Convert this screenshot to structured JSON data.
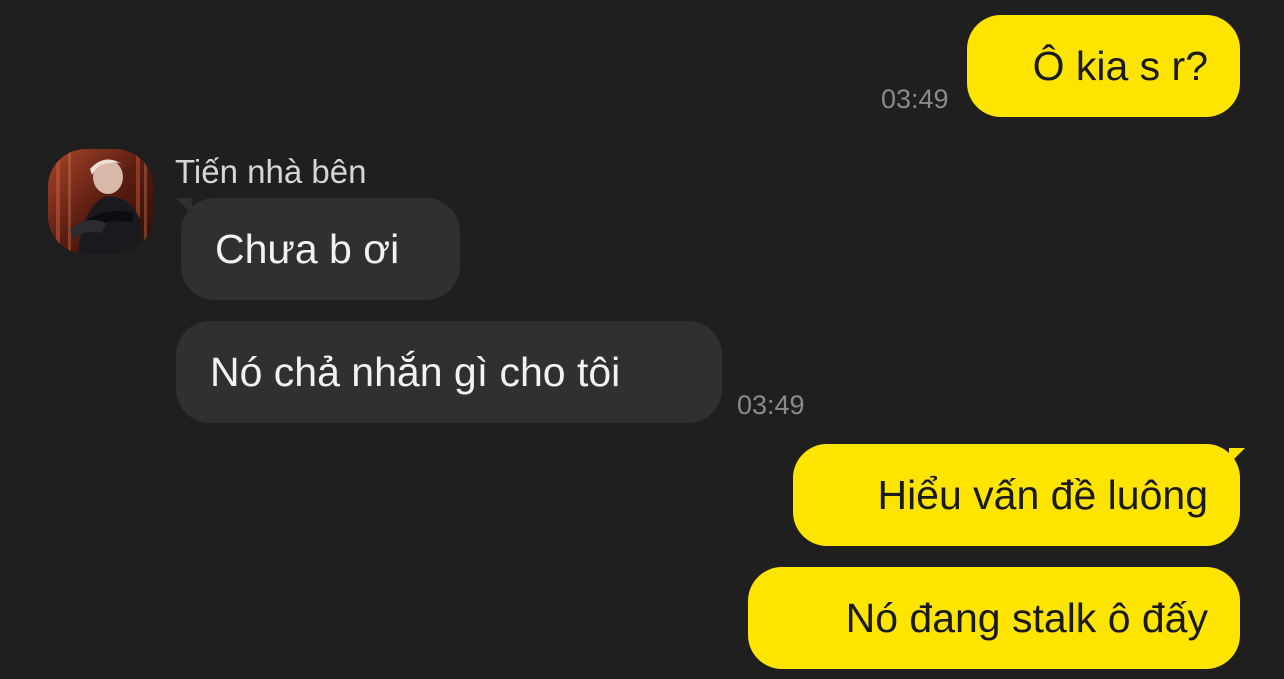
{
  "messages": [
    {
      "side": "me",
      "text": "Ô kia s r?",
      "time": "03:49"
    },
    {
      "side": "them",
      "sender": "Tiến nhà bên",
      "text": "Chưa b ơi"
    },
    {
      "side": "them",
      "text": "Nó chả nhắn gì cho tôi",
      "time": "03:49"
    },
    {
      "side": "me",
      "text": "Hiểu vấn đề luông"
    },
    {
      "side": "me",
      "text": "Nó đang stalk ô đấy"
    }
  ],
  "contact": {
    "name": "Tiến nhà bên",
    "avatar_icon": "contact-avatar-photo"
  },
  "colors": {
    "background": "#1f1f1f",
    "my_bubble": "#fee500",
    "their_bubble": "#303030",
    "timestamp": "#8a8a8a"
  }
}
